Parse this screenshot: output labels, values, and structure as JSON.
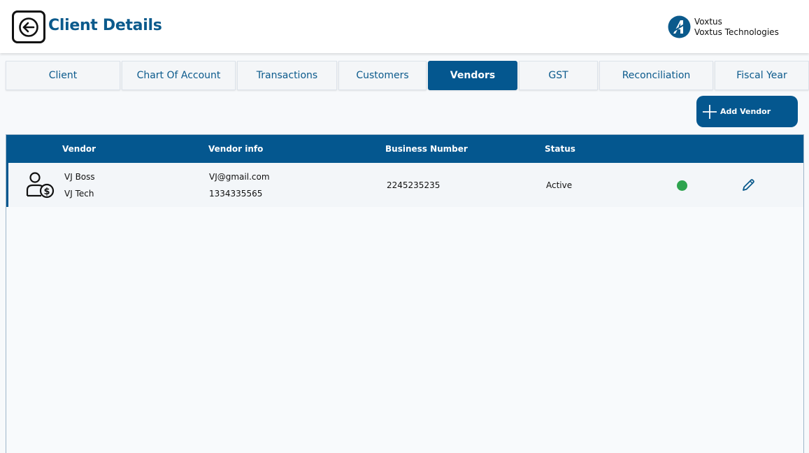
{
  "header": {
    "title": "Client Details",
    "brand_name": "Voxtus",
    "brand_company": "Voxtus Technologies",
    "back_icon": "arrow-left-icon"
  },
  "tabs": [
    {
      "label": "Client",
      "active": false
    },
    {
      "label": "Chart Of Account",
      "active": false
    },
    {
      "label": "Transactions",
      "active": false
    },
    {
      "label": "Customers",
      "active": false
    },
    {
      "label": "Vendors",
      "active": true
    },
    {
      "label": "GST",
      "active": false
    },
    {
      "label": "Reconciliation",
      "active": false
    },
    {
      "label": "Fiscal Year",
      "active": false
    }
  ],
  "actions": {
    "add_vendor_label": "Add Vendor"
  },
  "table": {
    "headers": [
      "Vendor",
      "Vendor info",
      "Business Number",
      "Status"
    ],
    "rows": [
      {
        "vendor_name": "VJ Boss",
        "vendor_company": "VJ Tech",
        "email": "VJ@gmail.com",
        "phone": "1334335565",
        "business_number": "2245235235",
        "status": "Active",
        "status_color": "#2ea44f"
      }
    ]
  },
  "colors": {
    "primary": "#04578f",
    "title": "#0b5a8c",
    "active_status": "#2ea44f"
  }
}
